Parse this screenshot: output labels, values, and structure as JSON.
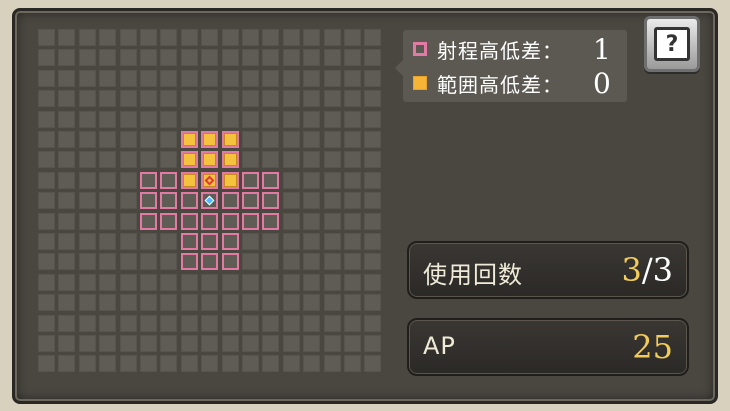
{
  "legend": {
    "range_label": "射程高低差：",
    "range_value": "1",
    "area_label": "範囲高低差：",
    "area_value": "0"
  },
  "help": {
    "label": "?",
    "icon": "help-book-icon"
  },
  "stats": {
    "uses_label": "使用回数",
    "uses_current": "3",
    "uses_sep": "/",
    "uses_max": "3",
    "ap_label": "AP",
    "ap_value": "25"
  },
  "grid": {
    "cols": 17,
    "rows": 17,
    "range_cells": [
      [
        7,
        5
      ],
      [
        8,
        5
      ],
      [
        9,
        5
      ],
      [
        7,
        6
      ],
      [
        8,
        6
      ],
      [
        9,
        6
      ],
      [
        5,
        7
      ],
      [
        6,
        7
      ],
      [
        7,
        7
      ],
      [
        8,
        7
      ],
      [
        9,
        7
      ],
      [
        10,
        7
      ],
      [
        11,
        7
      ],
      [
        5,
        8
      ],
      [
        6,
        8
      ],
      [
        7,
        8
      ],
      [
        8,
        8
      ],
      [
        9,
        8
      ],
      [
        10,
        8
      ],
      [
        11,
        8
      ],
      [
        5,
        9
      ],
      [
        6,
        9
      ],
      [
        7,
        9
      ],
      [
        8,
        9
      ],
      [
        9,
        9
      ],
      [
        10,
        9
      ],
      [
        11,
        9
      ],
      [
        7,
        10
      ],
      [
        8,
        10
      ],
      [
        9,
        10
      ],
      [
        7,
        11
      ],
      [
        8,
        11
      ],
      [
        9,
        11
      ]
    ],
    "area_cells": [
      [
        7,
        5
      ],
      [
        8,
        5
      ],
      [
        9,
        5
      ],
      [
        7,
        6
      ],
      [
        8,
        6
      ],
      [
        9,
        6
      ],
      [
        7,
        7
      ],
      [
        8,
        7
      ],
      [
        9,
        7
      ]
    ],
    "target_cell": [
      8,
      7
    ],
    "caster_cell": [
      8,
      8
    ]
  },
  "colors": {
    "range_border": "#e27aa4",
    "area_fill": "#f5c23d",
    "target_marker": "#e03a3a",
    "caster_marker": "#55b7ff",
    "gold_text": "#f1cc5a"
  }
}
